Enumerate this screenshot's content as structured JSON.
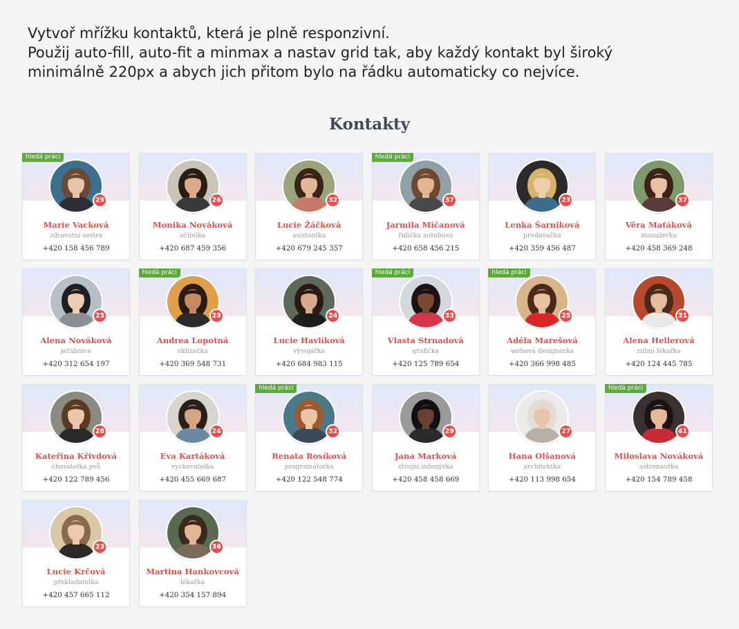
{
  "task": {
    "line1": "Vytvoř mřížku kontaktů, která je plně responzivní.",
    "line2": "Použij auto-fill, auto-fit a minmax a nastav grid tak, aby každý kontakt byl široký",
    "line3": "minimálně  220px a abych jich přitom bylo na řádku automaticky co nejvíce."
  },
  "heading": "Kontakty",
  "badge_label": "hledá práci",
  "colors": {
    "accent": "#e04f4b",
    "age_badge": "#e94b4b",
    "job_badge": "#5aaa3c",
    "heading": "#3e4a56"
  },
  "contacts": [
    {
      "name": "Marie Vacková",
      "job": "zdravotní sestra",
      "phone": "+420 158 456 789",
      "age": "29",
      "seeking": true,
      "photo": {
        "bg": "#3d6f8e",
        "hair": "#6b4a35",
        "skin": "#e8c3a8",
        "shirt": "#2a2f38"
      }
    },
    {
      "name": "Monika Nováková",
      "job": "učitelka",
      "phone": "+420 687 459 356",
      "age": "26",
      "seeking": false,
      "photo": {
        "bg": "#c9c3b8",
        "hair": "#2b1c14",
        "skin": "#d9a98a",
        "shirt": "#3a3a3a"
      }
    },
    {
      "name": "Lucie Žáčková",
      "job": "asistentka",
      "phone": "+420 679 245 357",
      "age": "32",
      "seeking": false,
      "photo": {
        "bg": "#9aa37a",
        "hair": "#3a2418",
        "skin": "#e2b89a",
        "shirt": "#c87a6a"
      }
    },
    {
      "name": "Jarmila Mičanová",
      "job": "řidička autobusu",
      "phone": "+420 658 456 215",
      "age": "37",
      "seeking": true,
      "photo": {
        "bg": "#8fa0a8",
        "hair": "#6d4a2e",
        "skin": "#e3b593",
        "shirt": "#4a4a4a"
      }
    },
    {
      "name": "Lenka Šarniková",
      "job": "prodavačka",
      "phone": "+420 359 456 487",
      "age": "23",
      "seeking": false,
      "photo": {
        "bg": "#2d2a2a",
        "hair": "#d9b26a",
        "skin": "#f0ccaf",
        "shirt": "#3b6d8c"
      }
    },
    {
      "name": "Věra Maťáková",
      "job": "manažerka",
      "phone": "+420 458 369 248",
      "age": "37",
      "seeking": false,
      "photo": {
        "bg": "#7f9a6a",
        "hair": "#3b2416",
        "skin": "#e7c1a6",
        "shirt": "#5a3a3a"
      }
    },
    {
      "name": "Alena Nováková",
      "job": "jeřábnice",
      "phone": "+420 312 654 197",
      "age": "25",
      "seeking": false,
      "photo": {
        "bg": "#b7bfc8",
        "hair": "#1e1e22",
        "skin": "#efcdb3",
        "shirt": "#8a8f96"
      }
    },
    {
      "name": "Andrea Lopotná",
      "job": "uklízečka",
      "phone": "+420 369 548 731",
      "age": "29",
      "seeking": true,
      "photo": {
        "bg": "#e0a04a",
        "hair": "#2a1a12",
        "skin": "#c58a62",
        "shirt": "#2a2a2a"
      }
    },
    {
      "name": "Lucie Havlíková",
      "job": "vývojářka",
      "phone": "+420 684 983 115",
      "age": "24",
      "seeking": false,
      "photo": {
        "bg": "#5d6a5a",
        "hair": "#2a1a14",
        "skin": "#d8ab8e",
        "shirt": "#1d1d1d"
      }
    },
    {
      "name": "Vlasta Strnadová",
      "job": "grafička",
      "phone": "+420 125 789 654",
      "age": "33",
      "seeking": true,
      "photo": {
        "bg": "#d4d7dc",
        "hair": "#1c1414",
        "skin": "#7a4a32",
        "shirt": "#d7364a"
      }
    },
    {
      "name": "Adéla Marešová",
      "job": "webová designerka",
      "phone": "+420 366 998 485",
      "age": "25",
      "seeking": true,
      "photo": {
        "bg": "#d9b58a",
        "hair": "#4a2a1a",
        "skin": "#e9c0a0",
        "shirt": "#d8262a"
      }
    },
    {
      "name": "Alena Hellerová",
      "job": "zubní lékařka",
      "phone": "+420 124 445 785",
      "age": "31",
      "seeking": false,
      "photo": {
        "bg": "#b74a2e",
        "hair": "#4a2a18",
        "skin": "#e6bd9e",
        "shirt": "#e8e8e8"
      }
    },
    {
      "name": "Kateřina Křivdová",
      "job": "chovatelka psů",
      "phone": "+420 122 789 456",
      "age": "28",
      "seeking": false,
      "photo": {
        "bg": "#8a8a80",
        "hair": "#5a3a22",
        "skin": "#ecc6aa",
        "shirt": "#2a2a2a"
      }
    },
    {
      "name": "Eva Kartáková",
      "job": "vychovatelka",
      "phone": "+420 455 669 687",
      "age": "24",
      "seeking": false,
      "photo": {
        "bg": "#d8d5cf",
        "hair": "#2a1e18",
        "skin": "#d4a584",
        "shirt": "#6a8aa4"
      }
    },
    {
      "name": "Renata Rosíková",
      "job": "programátorka",
      "phone": "+420 122 548 774",
      "age": "32",
      "seeking": true,
      "photo": {
        "bg": "#4a7a8a",
        "hair": "#9a5a32",
        "skin": "#ecc4a6",
        "shirt": "#3a4a5a"
      }
    },
    {
      "name": "Jana Marková",
      "job": "strojní inženýrka",
      "phone": "+420 458 458 669",
      "age": "29",
      "seeking": false,
      "photo": {
        "bg": "#9a9a9a",
        "hair": "#121010",
        "skin": "#6a4030",
        "shirt": "#2a2a2a"
      }
    },
    {
      "name": "Hana Olšanová",
      "job": "architektka",
      "phone": "+420 113 998 654",
      "age": "27",
      "seeking": false,
      "photo": {
        "bg": "#eaeaea",
        "hair": "#e4dcd0",
        "skin": "#e9c4aa",
        "shirt": "#b8b0a8"
      }
    },
    {
      "name": "Miloslava Nováková",
      "job": "astronautka",
      "phone": "+420 154 789 458",
      "age": "41",
      "seeking": true,
      "photo": {
        "bg": "#3a3030",
        "hair": "#1c1414",
        "skin": "#e6b896",
        "shirt": "#c82a3a"
      }
    },
    {
      "name": "Lucie Krčová",
      "job": "překladatelka",
      "phone": "+420 457 665 112",
      "age": "23",
      "seeking": false,
      "photo": {
        "bg": "#d9c8a8",
        "hair": "#8a6a4a",
        "skin": "#eec8aa",
        "shirt": "#2a2a2a"
      }
    },
    {
      "name": "Martina Hankovcová",
      "job": "lékařka",
      "phone": "+420 354 157 894",
      "age": "36",
      "seeking": false,
      "photo": {
        "bg": "#5a6a50",
        "hair": "#3a2a1c",
        "skin": "#e0b696",
        "shirt": "#7a6a5a"
      }
    }
  ]
}
